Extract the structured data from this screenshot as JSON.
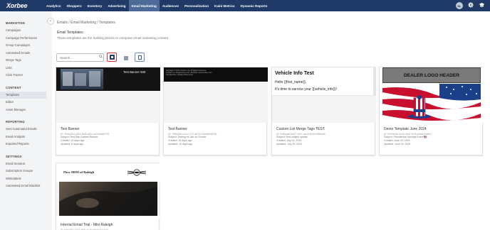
{
  "app": {
    "logo_main": "Xorbee",
    "brand_sub": ""
  },
  "topnav": {
    "items": [
      {
        "label": "Analytics"
      },
      {
        "label": "Shoppers"
      },
      {
        "label": "Inventory"
      },
      {
        "label": "Advertising"
      },
      {
        "label": "Email Marketing",
        "active": true
      },
      {
        "label": "Audiences"
      },
      {
        "label": "Personalization"
      },
      {
        "label": "Kaini Metrics"
      },
      {
        "label": "Dynamic Reports"
      }
    ],
    "user_initials": "NL",
    "icons": [
      "gear-icon",
      "graduation-cap-icon"
    ]
  },
  "sidebar": {
    "marketing_title": "MARKETING",
    "marketing_items": [
      {
        "label": "Campaigns"
      },
      {
        "label": "Campaign Performance"
      },
      {
        "label": "Group Campaigns"
      },
      {
        "label": "Automated Emails"
      },
      {
        "label": "Merge Tags"
      },
      {
        "label": "Lists"
      },
      {
        "label": "Click Tracker"
      }
    ],
    "content_title": "CONTENT",
    "content_items": [
      {
        "label": "Templates",
        "active": true
      },
      {
        "label": "Editor"
      },
      {
        "label": "Asset Manager"
      }
    ],
    "reporting_title": "REPORTING",
    "reporting_items": [
      {
        "label": "Sent Automated Emails"
      },
      {
        "label": "Email Analysis"
      },
      {
        "label": "Exported Reports"
      }
    ],
    "settings_title": "SETTINGS",
    "settings_items": [
      {
        "label": "Email Senders"
      },
      {
        "label": "Subscription Groups"
      },
      {
        "label": "Whitelabels"
      },
      {
        "label": "Automated Email Blacklist"
      }
    ]
  },
  "main": {
    "breadcrumb": "Emails / Email Marketing / Templates",
    "title": "Email Templates",
    "subtitle": "These templates are the building blocks to compose email marketing content.",
    "search_placeholder": "Search..."
  },
  "cards": [
    {
      "title": "Test Banner",
      "id": "ID: 3bdd42e1-e8f3-4b85-a61c-ac19a3d0575f",
      "subject": "Subject: Test Site Content Banner",
      "created": "Created: 13 days ago",
      "updated": "Updated: 6 days ago",
      "thumb_label": "Test Banner 930"
    },
    {
      "title": "Test Banner",
      "id": "ID: 7f98462b-c2cc-4721-a815-2d3cd90d876b",
      "subject": "Subject: Testing for use on Gmoke",
      "created": "Created: 16 days ago",
      "updated": "Updated: 13 days ago",
      "thumb_lines": [
        "Copyright © 2024 Xorbee, Ltd. All Rights Reserved.",
        "Contact us: info@xorbee.com | Website: www.xorbee.com",
        "Unsubscribe | Update Preferences"
      ]
    },
    {
      "title": "Custom List Merge Tags TEST",
      "id": "ID: fcd0eaa8-8a67-4047-aa13-e02bc938da06",
      "subject": "Subject: Test subject update",
      "created": "Created: July 01, 2024",
      "updated": "Updated: July 22, 2024",
      "thumb_heading": "Vehicle Info Test",
      "thumb_line1": "Hello {{first_name}},",
      "thumb_line2": "It's time to service your {{vehicle_info}}!"
    },
    {
      "title": "Demo Template June 2024",
      "id": "ID: 64056c3e-2a1b-4941-9c3f-e0fa6d7a5fe1",
      "subject": "Subject: Presidential Savings Event 🇺🇸",
      "created": "Created: June 20, 2024",
      "updated": "Updated: June 20, 2024",
      "thumb_header": "DEALER LOGO HEADER"
    },
    {
      "title": "Internal Email Trial - Mini Raleigh",
      "id": "ID: 9ab4f2f7-37d2-4f28-a17b-c8ba641bd010",
      "thumb_title": "Flow MINI of Raleigh"
    }
  ],
  "colors": {
    "nav_bg": "#1f3a66",
    "nav_active": "#4d6a98",
    "highlight": "#d62d2d"
  }
}
